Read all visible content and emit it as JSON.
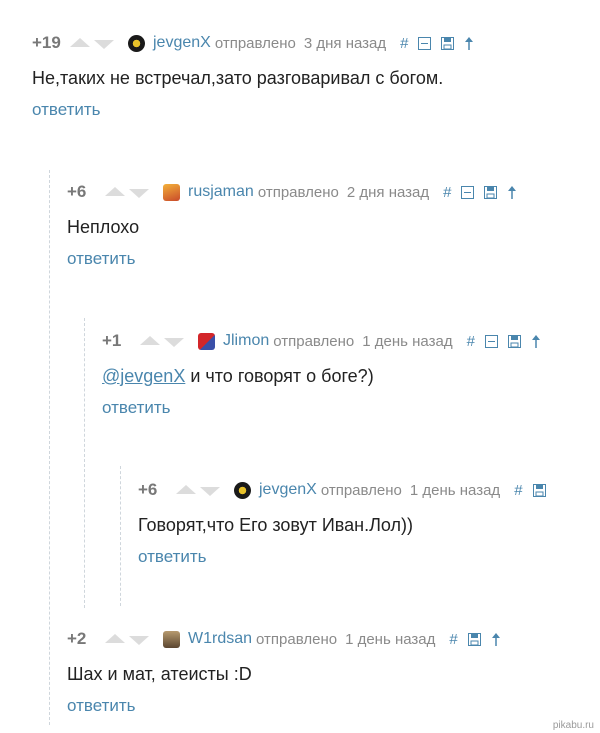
{
  "comments": [
    {
      "rating": "+19",
      "author": "jevgenX",
      "sent": "отправлено",
      "date": "3 дня назад",
      "text": "Не,таких не встречал,зато разговаривал с богом.",
      "reply": "ответить"
    },
    {
      "rating": "+6",
      "author": "rusjaman",
      "sent": "отправлено",
      "date": "2 дня назад",
      "text": "Неплохо",
      "reply": "ответить"
    },
    {
      "rating": "+1",
      "author": "Jlimon",
      "sent": "отправлено",
      "date": "1 день назад",
      "mention": "@jevgenX",
      "text": " и что говорят о боге?)",
      "reply": "ответить"
    },
    {
      "rating": "+6",
      "author": "jevgenX",
      "sent": "отправлено",
      "date": "1 день назад",
      "text": "Говорят,что Его зовут Иван.Лол))",
      "reply": "ответить"
    },
    {
      "rating": "+2",
      "author": "W1rdsan",
      "sent": "отправлено",
      "date": "1 день назад",
      "text": "Шах и мат, атеисты :D",
      "reply": "ответить"
    }
  ],
  "tools": {
    "link": "#"
  },
  "watermark": "pikabu.ru",
  "colors": {
    "link": "#4a86ad",
    "meta": "#8a8a8a",
    "rating": "#787878",
    "arrows": "#dcdcdc"
  }
}
